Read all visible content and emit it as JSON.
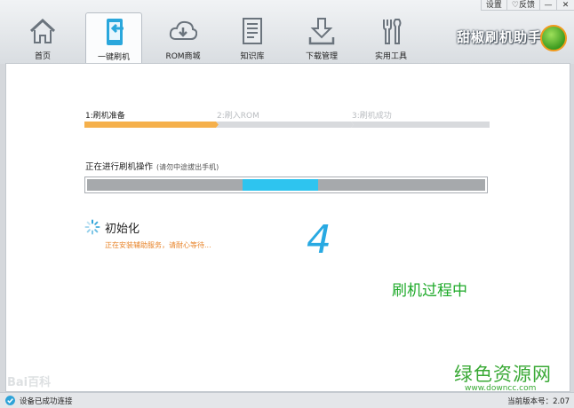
{
  "window": {
    "settings": "设置",
    "feedback_symbol": "♡",
    "feedback": "反馈",
    "minimize": "—",
    "close": "✕"
  },
  "nav": [
    {
      "label": "首页",
      "icon": "home-icon",
      "active": false
    },
    {
      "label": "一键刷机",
      "icon": "phone-flash-icon",
      "active": true
    },
    {
      "label": "ROM商城",
      "icon": "cloud-download-icon",
      "active": false
    },
    {
      "label": "知识库",
      "icon": "document-icon",
      "active": false
    },
    {
      "label": "下载管理",
      "icon": "download-tray-icon",
      "active": false
    },
    {
      "label": "实用工具",
      "icon": "tools-icon",
      "active": false
    }
  ],
  "logo": {
    "text": "甜椒刷机助手",
    "icon": "pepper-logo-icon"
  },
  "steps": [
    {
      "label": "1:刷机准备",
      "state": "done"
    },
    {
      "label": "2:刷入ROM",
      "state": "todo"
    },
    {
      "label": "3:刷机成功",
      "state": "todo"
    }
  ],
  "flash": {
    "title": "正在进行刷机操作",
    "note": "(请勿中途拔出手机)",
    "segment_start": 0.39,
    "segment_end": 0.58
  },
  "init": {
    "title": "初始化",
    "subtitle": "正在安装辅助服务，请耐心等待..."
  },
  "countdown": "4",
  "status_text": "刷机过程中",
  "watermarks": {
    "baidu": "Bai百科",
    "site": "绿色资源网",
    "url": "www.downcc.com"
  },
  "statusbar": {
    "connection": "设备已成功连接",
    "version": "当前版本号：2.07"
  },
  "colors": {
    "accent_orange": "#f5b04b",
    "progress_blue": "#2ec4ef",
    "status_green": "#1faa2a",
    "countdown_blue": "#28a9e2"
  }
}
